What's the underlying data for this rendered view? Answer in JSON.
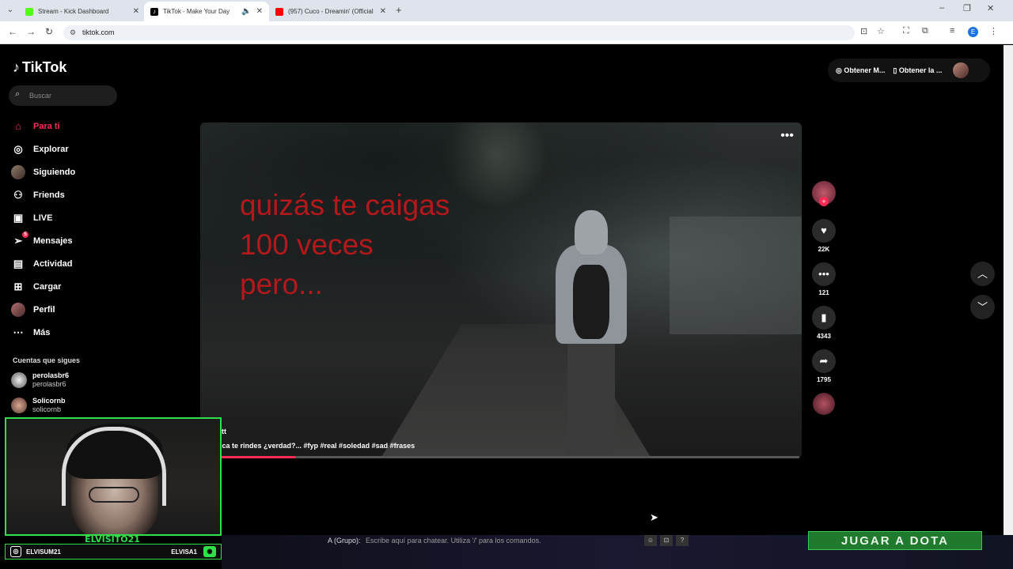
{
  "browser": {
    "tabs": [
      {
        "title": "Stream - Kick Dashboard",
        "favicon_color": "#53fc18"
      },
      {
        "title": "TikTok - Make Your Day",
        "favicon_color": "#000000",
        "active": true
      },
      {
        "title": "(957) Cuco - Dreamin' (Official",
        "favicon_color": "#ff0000"
      }
    ],
    "url": "tiktok.com",
    "profile_letter": "E"
  },
  "tiktok": {
    "logo": "TikTok",
    "search_placeholder": "Buscar",
    "nav": [
      {
        "label": "Para ti",
        "icon": "home-icon"
      },
      {
        "label": "Explorar",
        "icon": "compass-icon"
      },
      {
        "label": "Siguiendo",
        "icon": "following-avatar"
      },
      {
        "label": "Friends",
        "icon": "friends-icon"
      },
      {
        "label": "LIVE",
        "icon": "live-icon"
      },
      {
        "label": "Mensajes",
        "icon": "messages-icon",
        "badge": "5"
      },
      {
        "label": "Actividad",
        "icon": "activity-icon"
      },
      {
        "label": "Cargar",
        "icon": "upload-icon"
      },
      {
        "label": "Perfil",
        "icon": "profile-avatar"
      },
      {
        "label": "Más",
        "icon": "more-icon"
      }
    ],
    "following_header": "Cuentas que sigues",
    "following": [
      {
        "name": "perolasbr6",
        "username": "perolasbr6"
      },
      {
        "name": "Solicornb",
        "username": "solicornb"
      }
    ],
    "top_buttons": {
      "coins": "Obtener M...",
      "app": "Obtener la ..."
    },
    "video": {
      "caption_lines": [
        "quizás te caigas",
        "100 veces",
        "pero..."
      ],
      "username": "att",
      "description": "nca te rindes ¿verdad?... #fyp #real #soledad #sad #frases",
      "progress": 0.13
    },
    "actions": {
      "likes": "22K",
      "comments": "121",
      "saves": "4343",
      "shares": "1795"
    }
  },
  "overlay": {
    "streamer_name": "ELVISITO21",
    "instagram": "ELVISUM21",
    "discord": "ELVISA1",
    "chat_label": "A (Grupo):",
    "chat_placeholder": "Escribe aquí para chatear. Utiliza '/' para los comandos.",
    "game_button": "JUGAR A DOTA",
    "accent_color": "#2fe04a"
  }
}
